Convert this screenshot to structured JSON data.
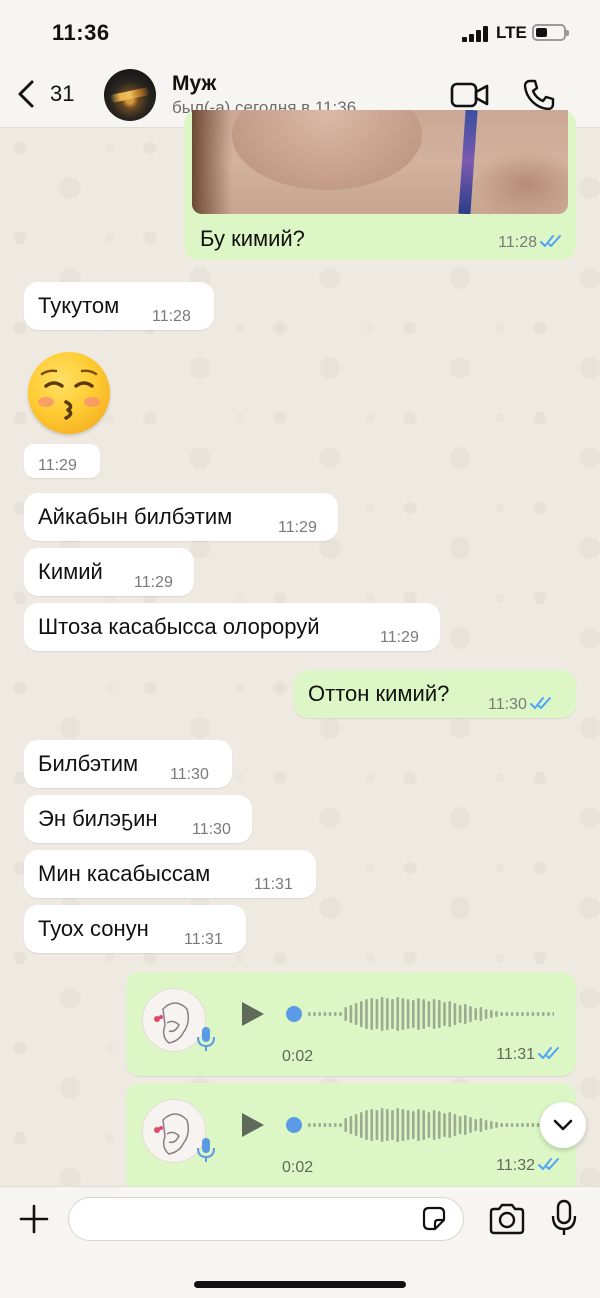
{
  "status_bar": {
    "time": "11:36",
    "network": "LTE"
  },
  "header": {
    "back_count": "31",
    "contact_name": "Муж",
    "last_seen": "был(-а) сегодня в 11:36",
    "video_icon": "video-camera-icon",
    "call_icon": "phone-icon"
  },
  "messages": [
    {
      "dir": "out",
      "type": "photo",
      "text": "Бу кимий?",
      "time": "11:28",
      "read": true
    },
    {
      "dir": "in",
      "type": "text",
      "text": "Тукутом",
      "time": "11:28"
    },
    {
      "dir": "in",
      "type": "emoji",
      "emoji": "kissing-face-with-closed-eyes",
      "time": "11:29"
    },
    {
      "dir": "in",
      "type": "text",
      "text": "Айкабын билбэтим",
      "time": "11:29"
    },
    {
      "dir": "in",
      "type": "text",
      "text": "Кимий",
      "time": "11:29"
    },
    {
      "dir": "in",
      "type": "text",
      "text": "Штоза касабысса олороруй",
      "time": "11:29"
    },
    {
      "dir": "out",
      "type": "text",
      "text": "Оттон кимий?",
      "time": "11:30",
      "read": true
    },
    {
      "dir": "in",
      "type": "text",
      "text": "Билбэтим",
      "time": "11:30"
    },
    {
      "dir": "in",
      "type": "text",
      "text": "Эн билэҕин",
      "time": "11:30"
    },
    {
      "dir": "in",
      "type": "text",
      "text": "Мин касабыссам",
      "time": "11:31"
    },
    {
      "dir": "in",
      "type": "text",
      "text": "Туох сонун",
      "time": "11:31"
    },
    {
      "dir": "out",
      "type": "voice",
      "duration": "0:02",
      "time": "11:31",
      "read": true
    },
    {
      "dir": "out",
      "type": "voice",
      "duration": "0:02",
      "time": "11:32",
      "read": true
    }
  ],
  "input": {
    "placeholder": "",
    "value": ""
  },
  "colors": {
    "outgoing": "#dcf7c5",
    "incoming": "#ffffff",
    "ticks": "#4fa3f7",
    "voice_dot": "#5b9be6"
  }
}
